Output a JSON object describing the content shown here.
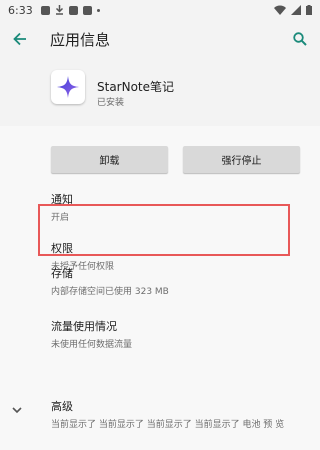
{
  "status_bar": {
    "time": "6:33"
  },
  "app_bar": {
    "title": "应用信息"
  },
  "app": {
    "name": "StarNote笔记",
    "status": "已安装"
  },
  "buttons": {
    "disable": "卸载",
    "force_stop": "强行停止"
  },
  "items": [
    {
      "title": "通知",
      "sub": "开启"
    },
    {
      "title": "权限",
      "sub": "未授予任何权限"
    },
    {
      "title": "存储",
      "sub": "内部存储空间已使用 323 MB"
    },
    {
      "title": "流量使用情况",
      "sub": "未使用任何数据流量"
    },
    {
      "title": "高级",
      "sub": "当前显示了 当前显示了 当前显示了 当前显示了 电池 预 览"
    }
  ],
  "colors": {
    "accent": "#1a8a7a",
    "highlight": "#e85858"
  }
}
